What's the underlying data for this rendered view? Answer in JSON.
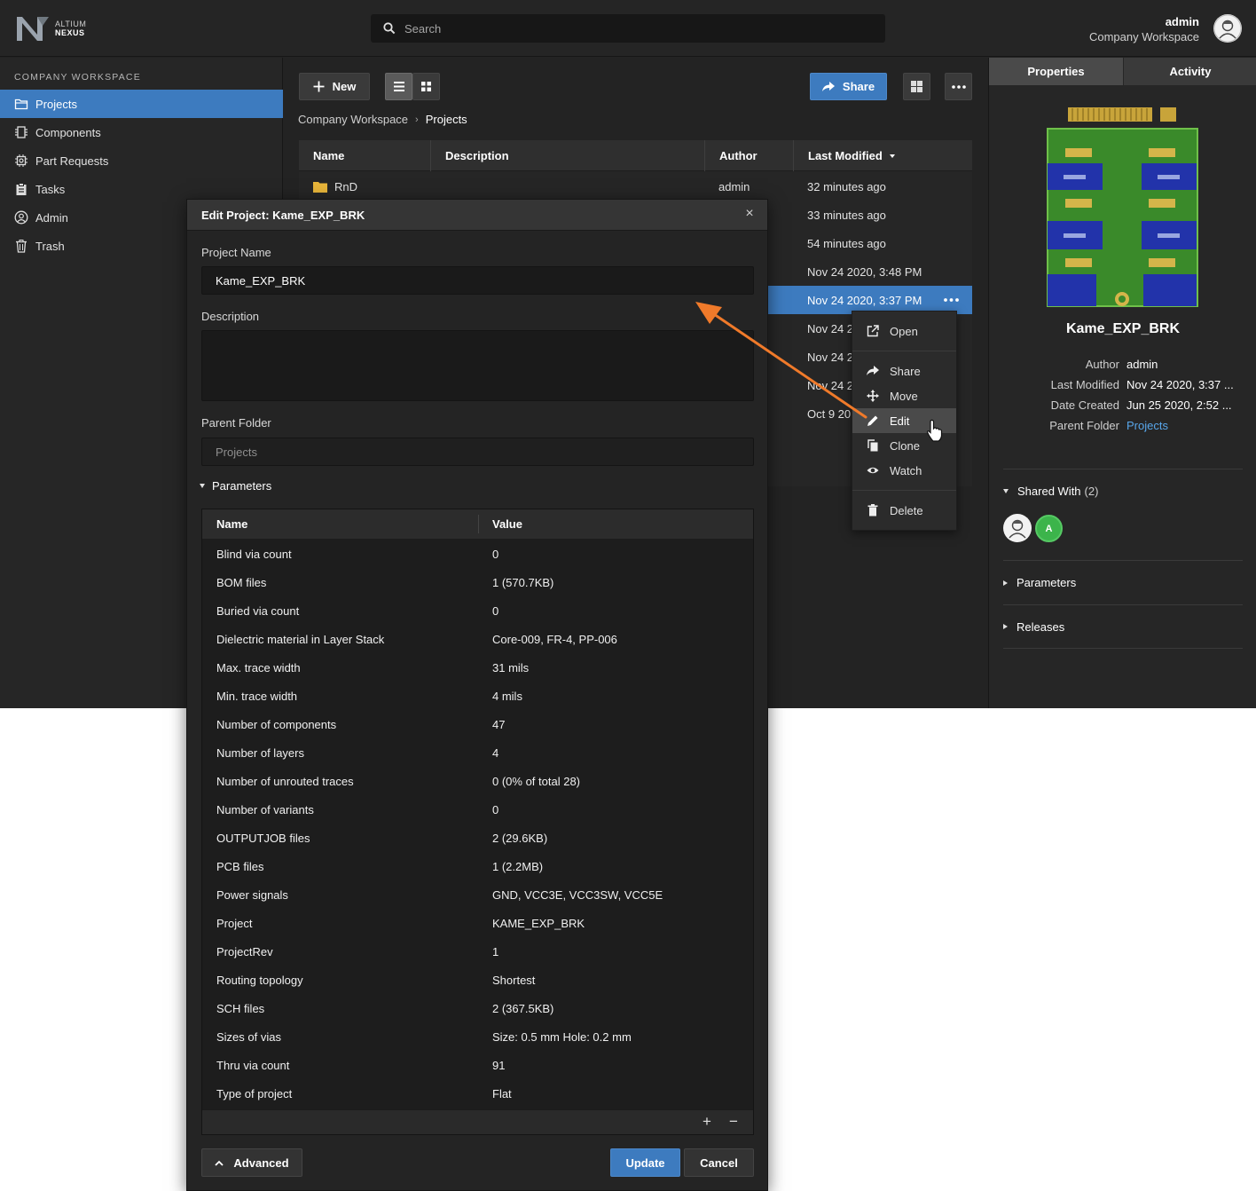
{
  "app": {
    "logo_line1": "ALTIUM",
    "logo_line2": "NEXUS",
    "search_placeholder": "Search",
    "user_name": "admin",
    "user_workspace": "Company Workspace"
  },
  "sidebar": {
    "title": "COMPANY WORKSPACE",
    "items": [
      {
        "label": "Projects",
        "icon": "folder-icon"
      },
      {
        "label": "Components",
        "icon": "component-icon"
      },
      {
        "label": "Part Requests",
        "icon": "part-request-icon"
      },
      {
        "label": "Tasks",
        "icon": "clipboard-icon"
      },
      {
        "label": "Admin",
        "icon": "user-circle-icon"
      },
      {
        "label": "Trash",
        "icon": "trash-icon"
      }
    ]
  },
  "toolbar": {
    "new_label": "New",
    "share_label": "Share"
  },
  "breadcrumb": [
    "Company Workspace",
    "Projects"
  ],
  "grid": {
    "columns": [
      "Name",
      "Description",
      "Author",
      "Last Modified"
    ],
    "rows": [
      {
        "name": "RnD",
        "author": "admin",
        "modified": "32 minutes ago"
      },
      {
        "name": "",
        "author": "",
        "modified": "33 minutes ago"
      },
      {
        "name": "",
        "author": "",
        "modified": "54 minutes ago"
      },
      {
        "name": "",
        "author": "",
        "modified": "Nov 24 2020, 3:48 PM"
      },
      {
        "name": "",
        "author": "",
        "modified": "Nov 24 2020, 3:37 PM"
      },
      {
        "name": "",
        "author": "",
        "modified": "Nov 24 2"
      },
      {
        "name": "",
        "author": "",
        "modified": "Nov 24 2"
      },
      {
        "name": "",
        "author": "",
        "modified": "Nov 24 2"
      },
      {
        "name": "",
        "author": "",
        "modified": "Oct 9 20"
      }
    ]
  },
  "context_menu": [
    {
      "label": "Open",
      "icon": "open-external-icon"
    },
    {
      "label": "Share",
      "icon": "share-arrow-icon"
    },
    {
      "label": "Move",
      "icon": "move-icon"
    },
    {
      "label": "Edit",
      "icon": "pencil-icon"
    },
    {
      "label": "Clone",
      "icon": "clone-icon"
    },
    {
      "label": "Watch",
      "icon": "eye-icon"
    },
    {
      "label": "Delete",
      "icon": "trash-icon"
    }
  ],
  "right_panel": {
    "tabs": [
      "Properties",
      "Activity"
    ],
    "project_title": "Kame_EXP_BRK",
    "props": [
      {
        "key": "Author",
        "value": "admin"
      },
      {
        "key": "Last Modified",
        "value": "Nov 24 2020, 3:37 ..."
      },
      {
        "key": "Date Created",
        "value": "Jun 25 2020, 2:52 ..."
      },
      {
        "key": "Parent Folder",
        "value": "Projects"
      }
    ],
    "shared_with": "Shared With",
    "shared_count": "(2)",
    "shared_avatar_letter": "A",
    "sections": [
      "Parameters",
      "Releases"
    ]
  },
  "dialog": {
    "title": "Edit Project: Kame_EXP_BRK",
    "close": "×",
    "project_name_label": "Project Name",
    "project_name_value": "Kame_EXP_BRK",
    "description_label": "Description",
    "description_value": "",
    "parent_folder_label": "Parent Folder",
    "parent_folder_value": "Projects",
    "parameters_label": "Parameters",
    "param_columns": [
      "Name",
      "Value"
    ],
    "params": [
      {
        "name": "Blind via count",
        "value": "0"
      },
      {
        "name": "BOM files",
        "value": "1 (570.7KB)"
      },
      {
        "name": "Buried via count",
        "value": "0"
      },
      {
        "name": "Dielectric material in Layer Stack",
        "value": "Core-009, FR-4, PP-006"
      },
      {
        "name": "Max. trace width",
        "value": "31 mils"
      },
      {
        "name": "Min. trace width",
        "value": "4 mils"
      },
      {
        "name": "Number of components",
        "value": "47"
      },
      {
        "name": "Number of layers",
        "value": "4"
      },
      {
        "name": "Number of unrouted traces",
        "value": "0 (0% of total 28)"
      },
      {
        "name": "Number of variants",
        "value": "0"
      },
      {
        "name": "OUTPUTJOB files",
        "value": "2 (29.6KB)"
      },
      {
        "name": "PCB files",
        "value": "1 (2.2MB)"
      },
      {
        "name": "Power signals",
        "value": "GND, VCC3E, VCC3SW, VCC5E"
      },
      {
        "name": "Project",
        "value": "KAME_EXP_BRK"
      },
      {
        "name": "ProjectRev",
        "value": "1"
      },
      {
        "name": "Routing topology",
        "value": "Shortest"
      },
      {
        "name": "SCH files",
        "value": "2 (367.5KB)"
      },
      {
        "name": "Sizes of vias",
        "value": "Size: 0.5 mm Hole: 0.2 mm"
      },
      {
        "name": "Thru via count",
        "value": "91"
      },
      {
        "name": "Type of project",
        "value": "Flat"
      }
    ],
    "add_symbol": "+",
    "remove_symbol": "−",
    "advanced_label": "Advanced",
    "update_label": "Update",
    "cancel_label": "Cancel"
  },
  "colors": {
    "accent_blue": "#3d7bbf",
    "annotation_orange": "#f07a2a",
    "link_blue": "#58a6ea",
    "avatar_green": "#3cb44b"
  }
}
